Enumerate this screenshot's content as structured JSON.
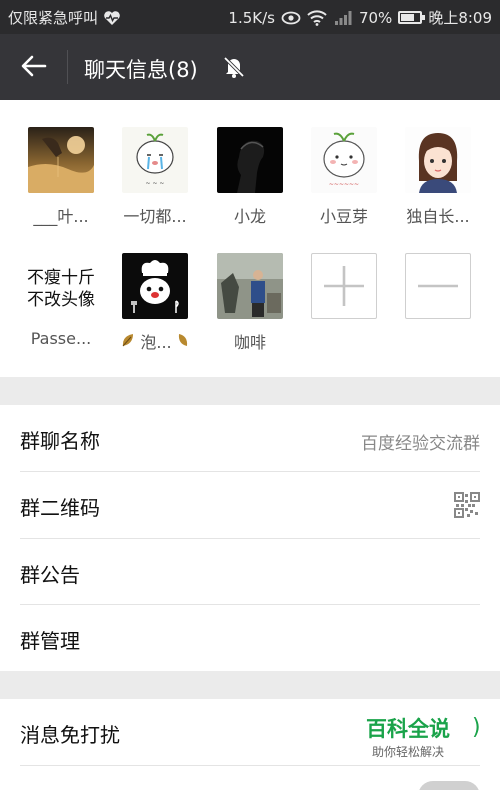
{
  "status_bar": {
    "carrier": "仅限紧急呼叫",
    "speed": "1.5K/s",
    "battery": "70%",
    "battery_level": 0.7,
    "time": "晚上8:09",
    "icons": [
      "heart-pulse-icon",
      "eye-icon",
      "wifi-icon",
      "signal-icon",
      "battery-icon"
    ]
  },
  "header": {
    "title": "聊天信息(8)",
    "back_icon": "back-arrow-icon",
    "mute_icon": "bell-off-icon"
  },
  "members": [
    {
      "name": "___叶...",
      "avatar": "desert-sand-photo"
    },
    {
      "name": "一切都...",
      "avatar": "crying-sprout-cartoon"
    },
    {
      "name": "小龙",
      "avatar": "dark-silhouette-photo"
    },
    {
      "name": "小豆芽",
      "avatar": "sprout-cartoon"
    },
    {
      "name": "独自长...",
      "avatar": "girl-illustration"
    },
    {
      "name": "Passe...",
      "avatar_text_line1": "不瘦十斤",
      "avatar_text_line2": "不改头像"
    },
    {
      "name": "泡...",
      "avatar": "chef-bear-cartoon",
      "name_prefix_icon": "leaf-icon",
      "name_suffix_icon": "leaf-icon"
    },
    {
      "name": "咖啡",
      "avatar": "street-photo"
    }
  ],
  "add_member_icon": "plus-icon",
  "remove_member_icon": "minus-icon",
  "settings": [
    {
      "label": "群聊名称",
      "value": "百度经验交流群"
    },
    {
      "label": "群二维码",
      "value_icon": "qrcode-icon"
    },
    {
      "label": "群公告"
    },
    {
      "label": "群管理"
    }
  ],
  "settings2": [
    {
      "label": "消息免打扰"
    }
  ],
  "watermark": {
    "main": "百科全说",
    "sub": "助你轻松解决",
    "paren": ")"
  },
  "colors": {
    "titlebar": "#353539",
    "statusbar": "#2b2b2d",
    "accent_green": "#1aa34a"
  }
}
